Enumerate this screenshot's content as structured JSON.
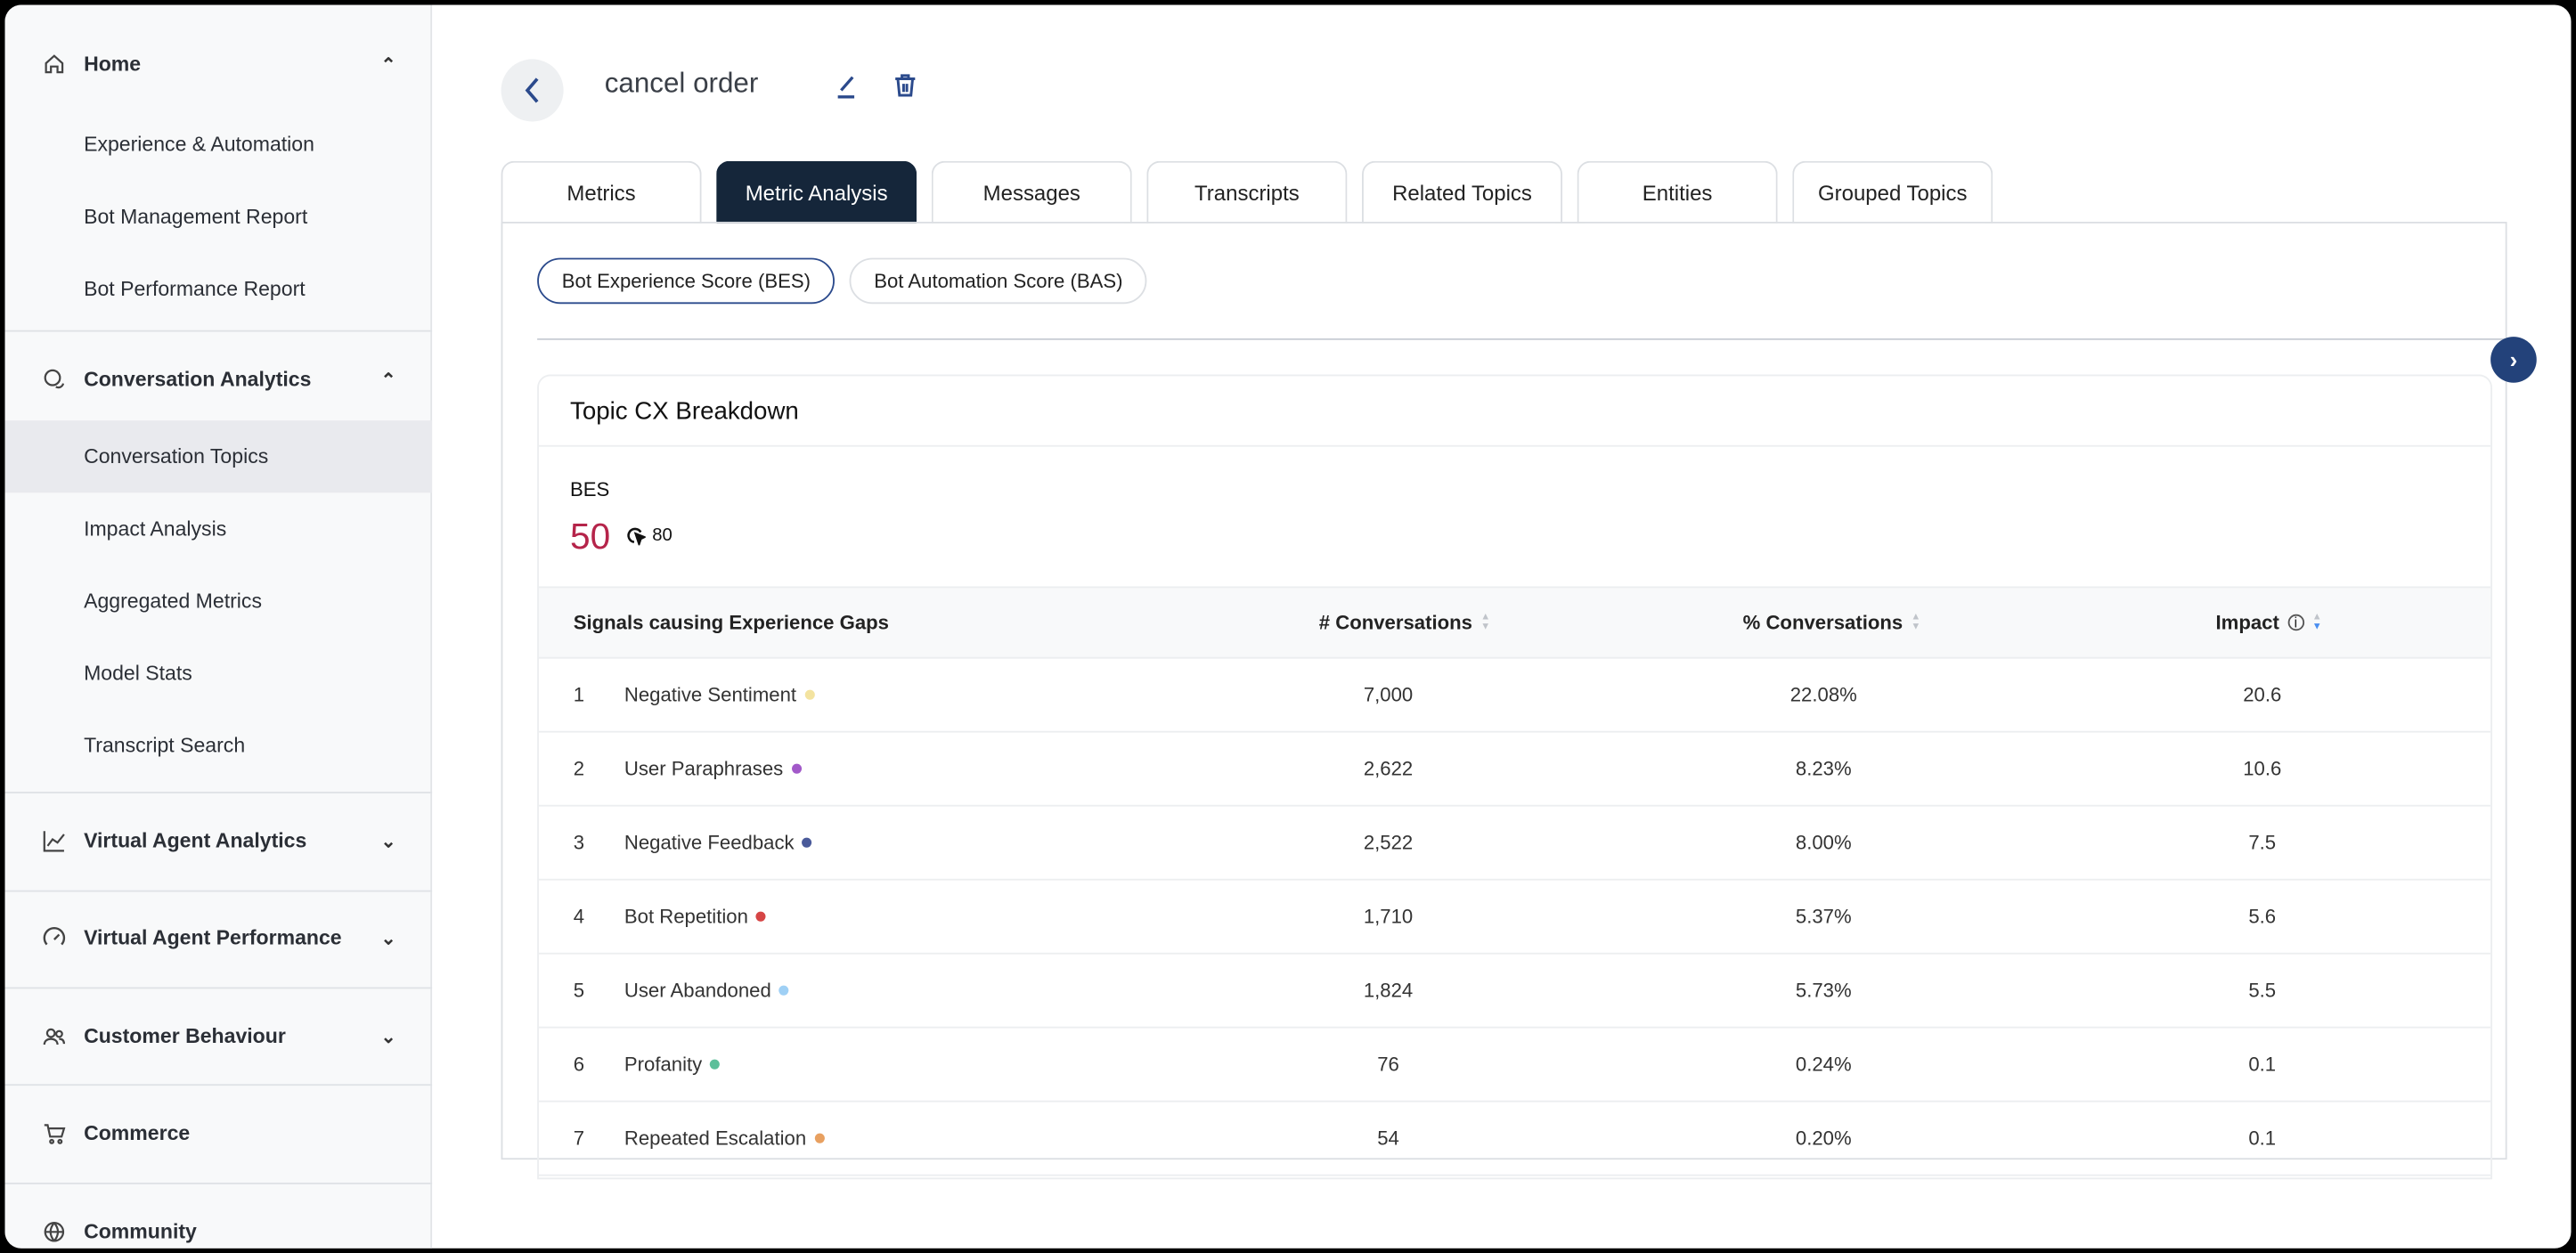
{
  "sidebar": {
    "home": {
      "label": "Home",
      "items": [
        "Experience & Automation",
        "Bot Management Report",
        "Bot Performance Report"
      ]
    },
    "conv": {
      "label": "Conversation Analytics",
      "items": [
        "Conversation Topics",
        "Impact Analysis",
        "Aggregated Metrics",
        "Model Stats",
        "Transcript Search"
      ]
    },
    "groups": [
      "Virtual Agent Analytics",
      "Virtual Agent Performance",
      "Customer Behaviour",
      "Commerce",
      "Community"
    ]
  },
  "header": {
    "title": "cancel order"
  },
  "tabs": [
    "Metrics",
    "Metric Analysis",
    "Messages",
    "Transcripts",
    "Related Topics",
    "Entities",
    "Grouped Topics"
  ],
  "pills": [
    "Bot Experience Score (BES)",
    "Bot Automation Score (BAS)"
  ],
  "card": {
    "title": "Topic CX Breakdown",
    "bes_label": "BES",
    "bes_value": "50",
    "bes_target": "80"
  },
  "table": {
    "headers": [
      "Signals causing Experience Gaps",
      "# Conversations",
      "% Conversations",
      "Impact"
    ],
    "rows": [
      {
        "n": "1",
        "name": "Negative Sentiment",
        "count": "7,000",
        "pct": "22.08%",
        "impact": "20.6",
        "color": "#f3e3a0"
      },
      {
        "n": "2",
        "name": "User Paraphrases",
        "count": "2,622",
        "pct": "8.23%",
        "impact": "10.6",
        "color": "#a259c9"
      },
      {
        "n": "3",
        "name": "Negative Feedback",
        "count": "2,522",
        "pct": "8.00%",
        "impact": "7.5",
        "color": "#4a5a9a"
      },
      {
        "n": "4",
        "name": "Bot Repetition",
        "count": "1,710",
        "pct": "5.37%",
        "impact": "5.6",
        "color": "#d64545"
      },
      {
        "n": "5",
        "name": "User Abandoned",
        "count": "1,824",
        "pct": "5.73%",
        "impact": "5.5",
        "color": "#9fd0f5"
      },
      {
        "n": "6",
        "name": "Profanity",
        "count": "76",
        "pct": "0.24%",
        "impact": "0.1",
        "color": "#5cbf9a"
      },
      {
        "n": "7",
        "name": "Repeated Escalation",
        "count": "54",
        "pct": "0.20%",
        "impact": "0.1",
        "color": "#e8a060"
      }
    ]
  }
}
